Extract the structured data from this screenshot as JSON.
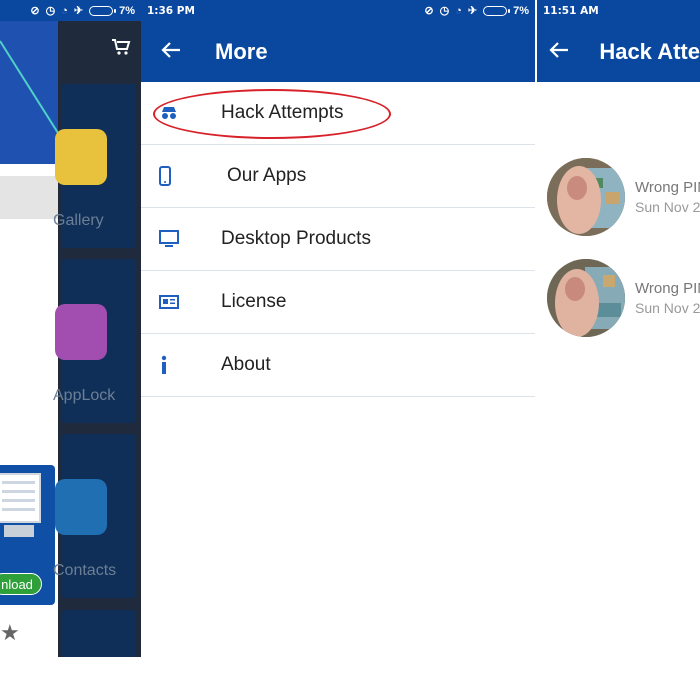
{
  "panel1": {
    "status_icons": [
      "⊘",
      "◷",
      "◔",
      "✈"
    ],
    "battery": "7%",
    "cart_icon": "cart-icon",
    "tiles": [
      {
        "label": "Gallery"
      },
      {
        "label": "AppLock"
      },
      {
        "label": "Contacts"
      }
    ],
    "download_label": "nload",
    "star": "★"
  },
  "panel2": {
    "status_time": "1:36 PM",
    "battery": "7%",
    "title": "More",
    "items": [
      {
        "label": "Hack Attempts",
        "icon": "spy-icon"
      },
      {
        "label": "Our Apps",
        "icon": "phone-icon"
      },
      {
        "label": "Desktop Products",
        "icon": "monitor-icon"
      },
      {
        "label": "License",
        "icon": "id-card-icon"
      },
      {
        "label": "About",
        "icon": "info-icon"
      }
    ]
  },
  "panel3": {
    "status_time": "11:51 AM",
    "title": "Hack Atte",
    "attempts": [
      {
        "title": "Wrong PIN",
        "date": "Sun Nov 2"
      },
      {
        "title": "Wrong PIN",
        "date": "Sun Nov 2"
      }
    ]
  },
  "colors": {
    "primary": "#0a48a0",
    "accent_red": "#d8222a",
    "icon_blue": "#1f5fbf",
    "download_green": "#2e9f39"
  }
}
